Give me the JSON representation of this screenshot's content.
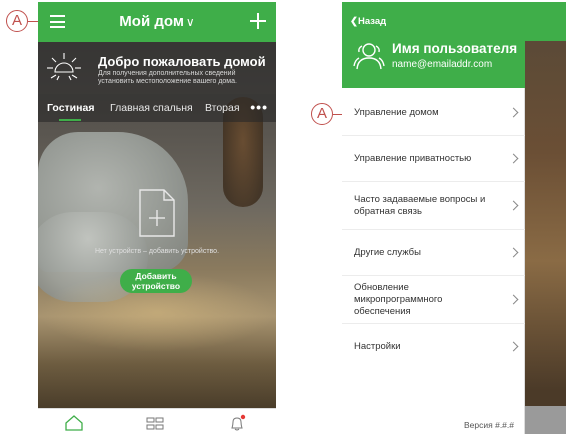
{
  "callouts": {
    "left_label": "A",
    "right_label": "A"
  },
  "home_screen": {
    "title": "Мой дом",
    "title_chevron": "∨",
    "welcome_title": "Добро пожаловать домой",
    "welcome_subtitle": "Для получения дополнительных сведений установить местоположение вашего дома.",
    "rooms": [
      "Гостиная",
      "Главная спальня",
      "Вторая"
    ],
    "active_room": "Гостиная",
    "more_label": "•••",
    "empty_message": "Нет устройств – добавить устройство.",
    "add_device_button": "Добавить устройство",
    "nav_icons": [
      "home-icon",
      "dashboard-grid-icon",
      "notification-bell-icon"
    ],
    "accent_color": "#3fae49",
    "notification_dot_color": "#e53935"
  },
  "menu_screen": {
    "back_label": "Назад",
    "user_name": "Имя пользователя",
    "user_email": "name@emailaddr.com",
    "items": [
      {
        "label": "Управление домом"
      },
      {
        "label": "Управление приватностью"
      },
      {
        "label": "Часто задаваемые вопросы и обратная связь"
      },
      {
        "label": "Другие службы"
      },
      {
        "label": "Обновление микропрограммного обеспечения"
      },
      {
        "label": "Настройки"
      }
    ],
    "version_label": "Версия #.#.#"
  }
}
